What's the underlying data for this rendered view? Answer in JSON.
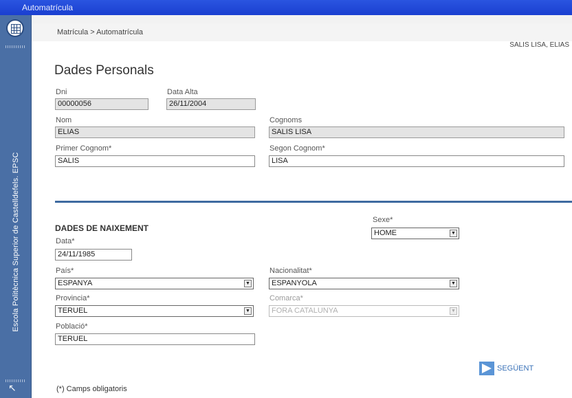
{
  "window": {
    "title": "Automatrícula"
  },
  "sidebar": {
    "school_name": "Escola Politècnica Superior de Castelldefels. EPSC"
  },
  "breadcrumb": "Matrícula > Automatrícula",
  "user": "SALIS LISA, ELIAS",
  "personal": {
    "heading": "Dades Personals",
    "dni": {
      "label": "Dni",
      "value": "00000056"
    },
    "data_alta": {
      "label": "Data Alta",
      "value": "26/11/2004"
    },
    "nom": {
      "label": "Nom",
      "value": "ELIAS"
    },
    "cognoms": {
      "label": "Cognoms",
      "value": "SALIS LISA"
    },
    "primer_cognom": {
      "label": "Primer Cognom*",
      "value": "SALIS"
    },
    "segon_cognom": {
      "label": "Segon Cognom*",
      "value": "LISA"
    }
  },
  "birth": {
    "heading": "DADES DE NAIXEMENT",
    "sexe": {
      "label": "Sexe*",
      "value": "HOME"
    },
    "data": {
      "label": "Data*",
      "value": "24/11/1985"
    },
    "pais": {
      "label": "País*",
      "value": "ESPANYA"
    },
    "nacionalitat": {
      "label": "Nacionalitat*",
      "value": "ESPANYOLA"
    },
    "provincia": {
      "label": "Provincia*",
      "value": "TERUEL"
    },
    "comarca": {
      "label": "Comarca*",
      "value": "FORA CATALUNYA"
    },
    "poblacio": {
      "label": "Població*",
      "value": "TERUEL"
    }
  },
  "actions": {
    "next_label": "SEGÜENT"
  },
  "footer_note": "(*) Camps obligatoris",
  "colors": {
    "titlebar": "#1a3fd0",
    "sidebar": "#4a6fa5",
    "divider": "#3e6aa0",
    "accent": "#5b95d6"
  },
  "icons": {
    "logo": "upc-logo-icon",
    "next": "arrow-right-icon",
    "corner": "cursor-arrow-icon",
    "dropdown": "chevron-down-icon"
  }
}
